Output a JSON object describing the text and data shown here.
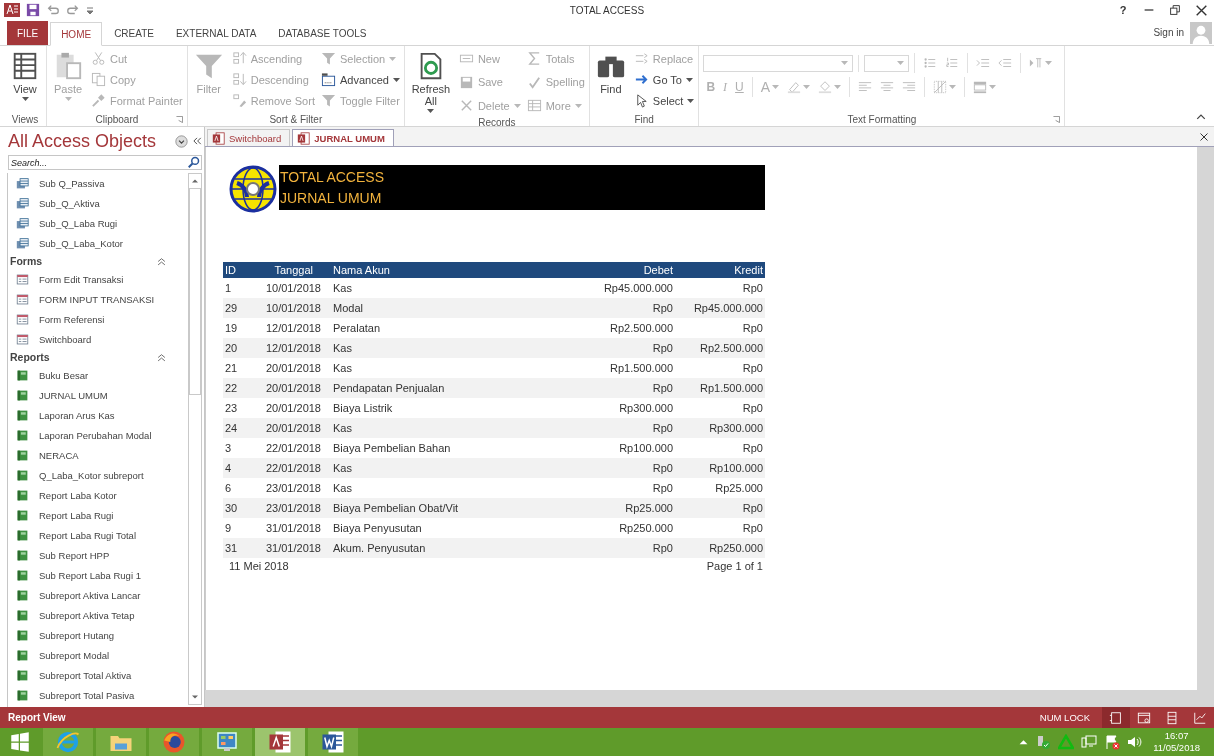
{
  "window": {
    "title": "TOTAL ACCESS",
    "help": "?"
  },
  "ribbon_tabs": [
    {
      "label": "FILE",
      "kind": "file",
      "selected": false
    },
    {
      "label": "HOME",
      "kind": "tab",
      "selected": true
    },
    {
      "label": "CREATE",
      "kind": "tab",
      "selected": false
    },
    {
      "label": "EXTERNAL DATA",
      "kind": "tab",
      "selected": false
    },
    {
      "label": "DATABASE TOOLS",
      "kind": "tab",
      "selected": false
    }
  ],
  "account": {
    "label": "Sign in"
  },
  "ribbon_groups": [
    {
      "title": "Views",
      "launcher": false,
      "columns": [
        [
          {
            "kind": "view",
            "label": "View",
            "disabled": false,
            "dropdown": true
          }
        ]
      ]
    },
    {
      "title": "Clipboard",
      "launcher": true,
      "columns": [
        [
          {
            "kind": "paste",
            "label": "Paste",
            "disabled": true,
            "dropdown": true
          }
        ],
        [
          {
            "kind": "cut",
            "label": "Cut",
            "disabled": true,
            "dropdown": false
          },
          {
            "kind": "copy",
            "label": "Copy",
            "disabled": true,
            "dropdown": false
          },
          {
            "kind": "painter",
            "label": "Format Painter",
            "disabled": true,
            "dropdown": false
          }
        ]
      ]
    },
    {
      "title": "Sort & Filter",
      "launcher": false,
      "columns": [
        [
          {
            "kind": "filter",
            "label": "Filter",
            "disabled": true,
            "dropdown": false
          }
        ],
        [
          {
            "kind": "ascending",
            "label": "Ascending",
            "disabled": true,
            "dropdown": false
          },
          {
            "kind": "descending",
            "label": "Descending",
            "disabled": true,
            "dropdown": false
          },
          {
            "kind": "removesort",
            "label": "Remove Sort",
            "disabled": true,
            "dropdown": false
          }
        ],
        [
          {
            "kind": "selection",
            "label": "Selection",
            "disabled": true,
            "dropdown": true
          },
          {
            "kind": "advanced",
            "label": "Advanced",
            "disabled": false,
            "dropdown": true
          },
          {
            "kind": "toggle",
            "label": "Toggle Filter",
            "disabled": true,
            "dropdown": false
          }
        ]
      ]
    },
    {
      "title": "Records",
      "launcher": false,
      "columns": [
        [
          {
            "kind": "refresh",
            "label": "Refresh All",
            "disabled": false,
            "dropdown": true
          }
        ],
        [
          {
            "kind": "new",
            "label": "New",
            "disabled": true,
            "dropdown": false
          },
          {
            "kind": "save",
            "label": "Save",
            "disabled": true,
            "dropdown": false
          },
          {
            "kind": "delete",
            "label": "Delete",
            "disabled": true,
            "dropdown": true
          }
        ],
        [
          {
            "kind": "totals",
            "label": "Totals",
            "disabled": true,
            "dropdown": false
          },
          {
            "kind": "spelling",
            "label": "Spelling",
            "disabled": true,
            "dropdown": false
          },
          {
            "kind": "more",
            "label": "More",
            "disabled": true,
            "dropdown": true
          }
        ]
      ]
    },
    {
      "title": "Find",
      "launcher": false,
      "columns": [
        [
          {
            "kind": "find",
            "label": "Find",
            "disabled": false,
            "dropdown": false
          }
        ],
        [
          {
            "kind": "replace",
            "label": "Replace",
            "disabled": true,
            "dropdown": false
          },
          {
            "kind": "goto",
            "label": "Go To",
            "disabled": false,
            "dropdown": true
          },
          {
            "kind": "select",
            "label": "Select",
            "disabled": false,
            "dropdown": true
          }
        ]
      ]
    }
  ],
  "text_formatting": {
    "title": "Text Formatting",
    "launcher": true,
    "rows": [
      [
        [
          {
            "kind": "fontbox",
            "disabled": true
          }
        ],
        [
          {
            "kind": "sizebox",
            "disabled": true
          }
        ],
        [
          {
            "kind": "bullets",
            "disabled": true,
            "dropdown": false
          },
          {
            "kind": "numbering",
            "disabled": true,
            "dropdown": false
          }
        ],
        [
          {
            "kind": "indent",
            "disabled": true,
            "dropdown": false
          },
          {
            "kind": "outdent",
            "disabled": true,
            "dropdown": false
          }
        ],
        [
          {
            "kind": "paragraph",
            "disabled": true,
            "dropdown": true
          }
        ]
      ],
      [
        [
          {
            "kind": "bold",
            "label": "B",
            "disabled": true,
            "dropdown": false
          },
          {
            "kind": "italic",
            "label": "I",
            "disabled": true,
            "dropdown": false
          },
          {
            "kind": "underline",
            "label": "U",
            "disabled": true,
            "dropdown": false
          }
        ],
        [
          {
            "kind": "fontcolor",
            "label": "A",
            "disabled": true,
            "dropdown": true
          },
          {
            "kind": "highlight",
            "disabled": true,
            "dropdown": true
          },
          {
            "kind": "fill",
            "disabled": true,
            "dropdown": true
          }
        ],
        [
          {
            "kind": "alignleft",
            "disabled": true,
            "dropdown": false
          },
          {
            "kind": "aligncenter",
            "disabled": true,
            "dropdown": false
          },
          {
            "kind": "alignright",
            "disabled": true,
            "dropdown": false
          }
        ],
        [
          {
            "kind": "gridlines",
            "disabled": true,
            "dropdown": true
          }
        ],
        [
          {
            "kind": "altrow",
            "disabled": true,
            "dropdown": true
          }
        ]
      ]
    ]
  },
  "nav": {
    "title": "All Access Objects",
    "search": {
      "placeholder": "Search..."
    },
    "groups": [
      {
        "kind": "query",
        "items": [
          "Sub Q_Passiva",
          "Sub_Q_Aktiva",
          "Sub_Q_Laba Rugi",
          "Sub_Q_Laba_Kotor"
        ]
      },
      {
        "kind": "form",
        "title": "Forms",
        "expanded": true,
        "items": [
          "Form Edit Transaksi",
          "FORM INPUT TRANSAKSI",
          "Form Referensi",
          "Switchboard"
        ]
      },
      {
        "kind": "report",
        "title": "Reports",
        "expanded": true,
        "items": [
          "Buku Besar",
          "JURNAL UMUM",
          "Laporan Arus Kas",
          "Laporan Perubahan Modal",
          "NERACA",
          "Q_Laba_Kotor subreport",
          "Report Laba Kotor",
          "Report Laba Rugi",
          "Report Laba Rugi Total",
          "Sub Report HPP",
          "Sub Report Laba Rugi 1",
          "Subreport Aktiva Lancar",
          "Subreport Aktiva Tetap",
          "Subreport Hutang",
          "Subreport Modal",
          "Subreport Total Aktiva",
          "Subreport Total Pasiva"
        ]
      }
    ]
  },
  "doc_tabs": [
    {
      "label": "Switchboard",
      "selected": false
    },
    {
      "label": "JURNAL UMUM",
      "selected": true
    }
  ],
  "report": {
    "title": "TOTAL ACCESS",
    "subtitle": "JURNAL UMUM",
    "columns": [
      "ID",
      "Tanggal",
      "Nama Akun",
      "Debet",
      "Kredit"
    ],
    "rows": [
      [
        "1",
        "10/01/2018",
        "Kas",
        "Rp45.000.000",
        "Rp0"
      ],
      [
        "29",
        "10/01/2018",
        "Modal",
        "Rp0",
        "Rp45.000.000"
      ],
      [
        "19",
        "12/01/2018",
        "Peralatan",
        "Rp2.500.000",
        "Rp0"
      ],
      [
        "20",
        "12/01/2018",
        "Kas",
        "Rp0",
        "Rp2.500.000"
      ],
      [
        "21",
        "20/01/2018",
        "Kas",
        "Rp1.500.000",
        "Rp0"
      ],
      [
        "22",
        "20/01/2018",
        "Pendapatan Penjualan",
        "Rp0",
        "Rp1.500.000"
      ],
      [
        "23",
        "20/01/2018",
        "Biaya Listrik",
        "Rp300.000",
        "Rp0"
      ],
      [
        "24",
        "20/01/2018",
        "Kas",
        "Rp0",
        "Rp300.000"
      ],
      [
        "3",
        "22/01/2018",
        "Biaya Pembelian Bahan",
        "Rp100.000",
        "Rp0"
      ],
      [
        "4",
        "22/01/2018",
        "Kas",
        "Rp0",
        "Rp100.000"
      ],
      [
        "6",
        "23/01/2018",
        "Kas",
        "Rp0",
        "Rp25.000"
      ],
      [
        "30",
        "23/01/2018",
        "Biaya Pembelian Obat/Vit",
        "Rp25.000",
        "Rp0"
      ],
      [
        "9",
        "31/01/2018",
        "Biaya Penyusutan",
        "Rp250.000",
        "Rp0"
      ],
      [
        "31",
        "31/01/2018",
        "Akum. Penyusutan",
        "Rp0",
        "Rp250.000"
      ]
    ],
    "printed_date": "11 Mei 2018",
    "page": "Page 1 of 1"
  },
  "status_bar": {
    "label": "Report View",
    "indicator": "NUM LOCK",
    "views": [
      {
        "kind": "report",
        "selected": true
      },
      {
        "kind": "preview",
        "selected": false
      },
      {
        "kind": "layout",
        "selected": false
      },
      {
        "kind": "design",
        "selected": false
      }
    ]
  },
  "taskbar": {
    "apps": [
      {
        "kind": "start",
        "selected": false
      },
      {
        "kind": "browser",
        "selected": false
      },
      {
        "kind": "explorer",
        "selected": false
      },
      {
        "kind": "firefox",
        "selected": false
      },
      {
        "kind": "control",
        "selected": false
      },
      {
        "kind": "access",
        "selected": true
      },
      {
        "kind": "word",
        "selected": false
      }
    ],
    "time": "16:07",
    "date": "11/05/2018"
  }
}
